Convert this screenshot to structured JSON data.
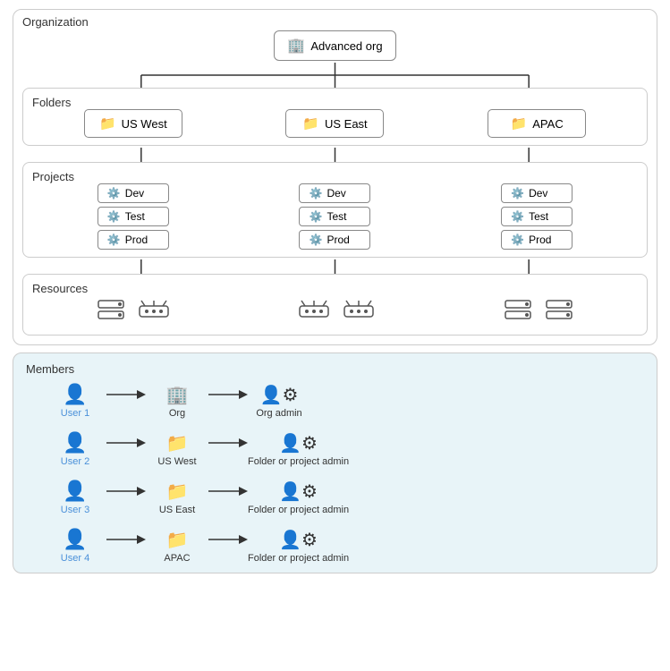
{
  "org": {
    "label": "Organization",
    "node_name": "Advanced org",
    "icon": "🏢"
  },
  "folders": {
    "label": "Folders",
    "items": [
      {
        "name": "US West"
      },
      {
        "name": "US East"
      },
      {
        "name": "APAC"
      }
    ]
  },
  "projects": {
    "label": "Projects",
    "groups": [
      {
        "items": [
          "Dev",
          "Test",
          "Prod"
        ]
      },
      {
        "items": [
          "Dev",
          "Test",
          "Prod"
        ]
      },
      {
        "items": [
          "Dev",
          "Test",
          "Prod"
        ]
      }
    ]
  },
  "resources": {
    "label": "Resources"
  },
  "members": {
    "label": "Members",
    "rows": [
      {
        "user": "User 1",
        "target": "Org",
        "role": "Org admin"
      },
      {
        "user": "User 2",
        "target": "US West",
        "role": "Folder or project admin"
      },
      {
        "user": "User 3",
        "target": "US East",
        "role": "Folder or project admin"
      },
      {
        "user": "User 4",
        "target": "APAC",
        "role": "Folder or project admin"
      }
    ]
  }
}
